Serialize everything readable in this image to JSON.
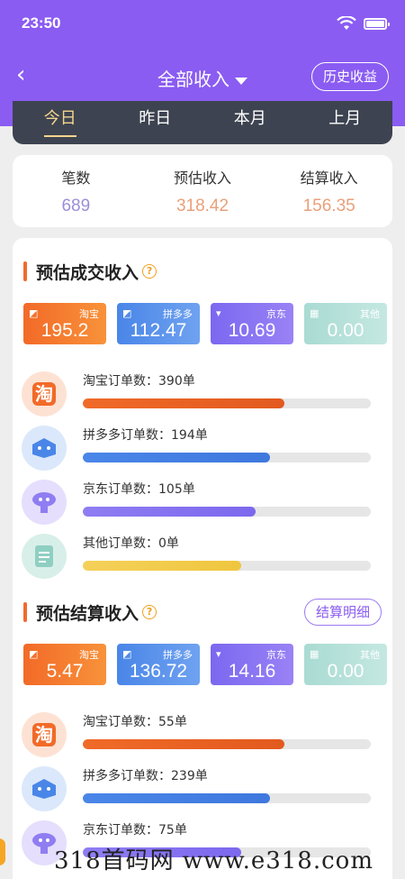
{
  "status": {
    "time": "23:50"
  },
  "nav": {
    "back": "‹",
    "title": "全部收入",
    "history": "历史收益"
  },
  "tabs": [
    "今日",
    "昨日",
    "本月",
    "上月"
  ],
  "summary": [
    {
      "label": "笔数",
      "value": "689",
      "color": "#9a8fd8"
    },
    {
      "label": "预估收入",
      "value": "318.42",
      "color": "#e9a07a"
    },
    {
      "label": "结算收入",
      "value": "156.35",
      "color": "#e9a07a"
    }
  ],
  "estimate": {
    "title": "预估成交收入",
    "help": "?",
    "tiles": [
      {
        "name": "淘宝",
        "value": "195.2"
      },
      {
        "name": "拼多多",
        "value": "112.47"
      },
      {
        "name": "京东",
        "value": "10.69"
      },
      {
        "name": "其他",
        "value": "0.00"
      }
    ],
    "rows": [
      {
        "label": "淘宝订单数：390单",
        "fill": 0.7
      },
      {
        "label": "拼多多订单数：194单",
        "fill": 0.65
      },
      {
        "label": "京东订单数：105单",
        "fill": 0.6
      },
      {
        "label": "其他订单数：0单",
        "fill": 0.55
      }
    ]
  },
  "settle": {
    "title": "预估结算收入",
    "help": "?",
    "detail": "结算明细",
    "tiles": [
      {
        "name": "淘宝",
        "value": "5.47"
      },
      {
        "name": "拼多多",
        "value": "136.72"
      },
      {
        "name": "京东",
        "value": "14.16"
      },
      {
        "name": "其他",
        "value": "0.00"
      }
    ],
    "rows": [
      {
        "label": "淘宝订单数：55单",
        "fill": 0.7
      },
      {
        "label": "拼多多订单数：239单",
        "fill": 0.65
      },
      {
        "label": "京东订单数：75单",
        "fill": 0.55
      }
    ]
  },
  "watermark": "318首码网 www.e318.com",
  "icons": {
    "taobao": "淘"
  }
}
